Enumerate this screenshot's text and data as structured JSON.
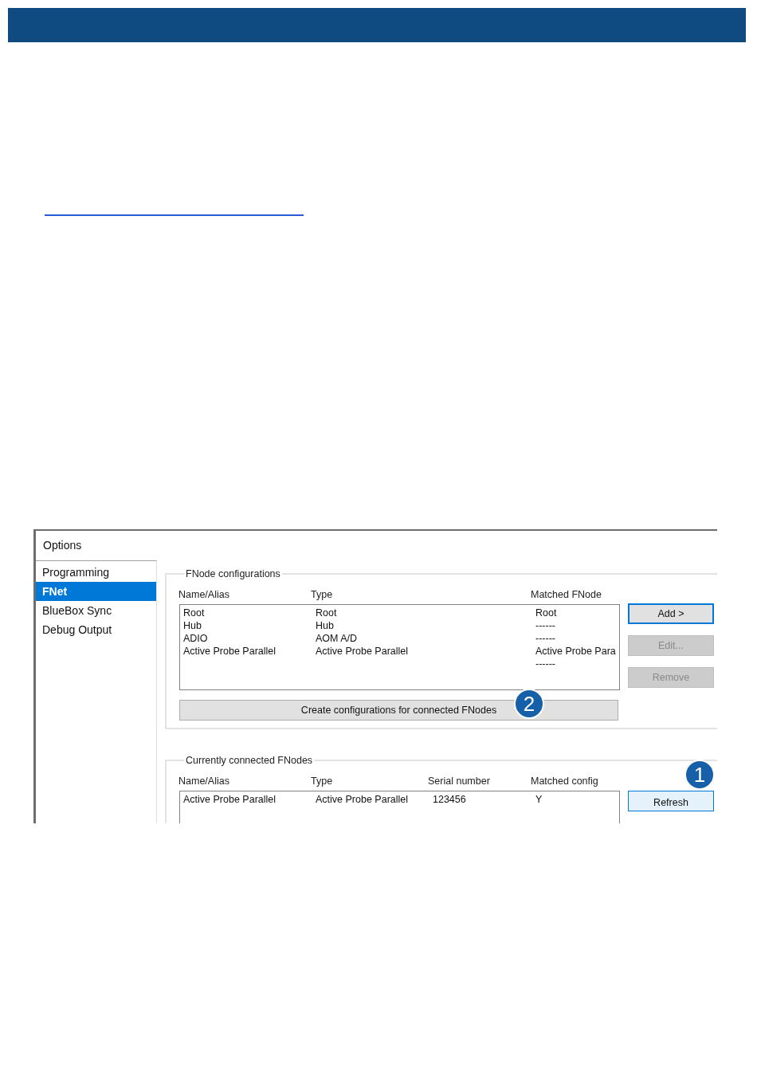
{
  "options_window": {
    "title": "Options",
    "sidebar": {
      "items": [
        {
          "label": "Programming",
          "selected": false
        },
        {
          "label": "FNet",
          "selected": true
        },
        {
          "label": "BlueBox Sync",
          "selected": false
        },
        {
          "label": "Debug Output",
          "selected": false
        }
      ]
    },
    "fnode_configurations": {
      "title": "FNode configurations",
      "columns": [
        "Name/Alias",
        "Type",
        "Matched FNode"
      ],
      "rows": [
        {
          "name_alias": "Root",
          "type": "Root",
          "matched_fnode": "Root"
        },
        {
          "name_alias": "Hub",
          "type": "Hub",
          "matched_fnode": "------"
        },
        {
          "name_alias": "ADIO",
          "type": "AOM A/D",
          "matched_fnode": "------"
        },
        {
          "name_alias": "Active Probe Parallel",
          "type": "Active Probe Parallel",
          "matched_fnode": "Active Probe Para"
        },
        {
          "matched_fnode": "------"
        }
      ],
      "buttons": [
        {
          "label": "Add >",
          "kind": "default"
        },
        {
          "label": "Edit...",
          "kind": "disabled"
        },
        {
          "label": "Remove",
          "kind": "disabled"
        }
      ],
      "create_button": {
        "label": "Create configurations for connected FNodes"
      },
      "callout": "2"
    },
    "connected_fnodes": {
      "title": "Currently connected FNodes",
      "columns": [
        "Name/Alias",
        "Type",
        "Serial number",
        "Matched config"
      ],
      "rows": [
        {
          "name_alias": "Active Probe Parallel",
          "type": "Active Probe Parallel",
          "serial_number": "123456",
          "matched_config": "Y"
        }
      ],
      "buttons": [
        {
          "label": "Refresh",
          "kind": "hover"
        }
      ],
      "callout": "1"
    }
  }
}
